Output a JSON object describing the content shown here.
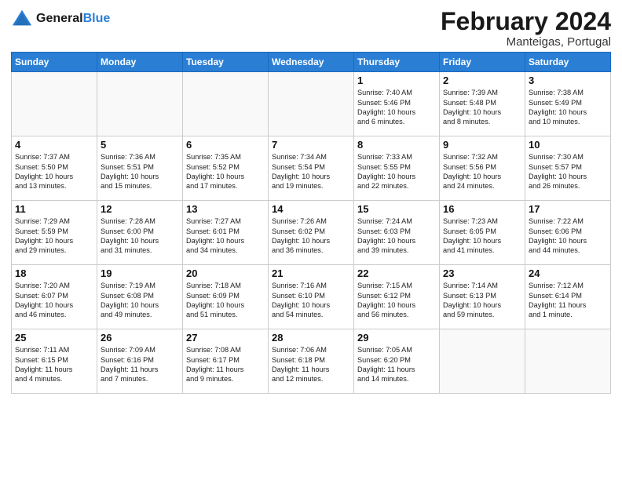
{
  "header": {
    "logo_line1": "General",
    "logo_line2": "Blue",
    "month": "February 2024",
    "location": "Manteigas, Portugal"
  },
  "days_of_week": [
    "Sunday",
    "Monday",
    "Tuesday",
    "Wednesday",
    "Thursday",
    "Friday",
    "Saturday"
  ],
  "weeks": [
    [
      {
        "day": "",
        "info": ""
      },
      {
        "day": "",
        "info": ""
      },
      {
        "day": "",
        "info": ""
      },
      {
        "day": "",
        "info": ""
      },
      {
        "day": "1",
        "info": "Sunrise: 7:40 AM\nSunset: 5:46 PM\nDaylight: 10 hours\nand 6 minutes."
      },
      {
        "day": "2",
        "info": "Sunrise: 7:39 AM\nSunset: 5:48 PM\nDaylight: 10 hours\nand 8 minutes."
      },
      {
        "day": "3",
        "info": "Sunrise: 7:38 AM\nSunset: 5:49 PM\nDaylight: 10 hours\nand 10 minutes."
      }
    ],
    [
      {
        "day": "4",
        "info": "Sunrise: 7:37 AM\nSunset: 5:50 PM\nDaylight: 10 hours\nand 13 minutes."
      },
      {
        "day": "5",
        "info": "Sunrise: 7:36 AM\nSunset: 5:51 PM\nDaylight: 10 hours\nand 15 minutes."
      },
      {
        "day": "6",
        "info": "Sunrise: 7:35 AM\nSunset: 5:52 PM\nDaylight: 10 hours\nand 17 minutes."
      },
      {
        "day": "7",
        "info": "Sunrise: 7:34 AM\nSunset: 5:54 PM\nDaylight: 10 hours\nand 19 minutes."
      },
      {
        "day": "8",
        "info": "Sunrise: 7:33 AM\nSunset: 5:55 PM\nDaylight: 10 hours\nand 22 minutes."
      },
      {
        "day": "9",
        "info": "Sunrise: 7:32 AM\nSunset: 5:56 PM\nDaylight: 10 hours\nand 24 minutes."
      },
      {
        "day": "10",
        "info": "Sunrise: 7:30 AM\nSunset: 5:57 PM\nDaylight: 10 hours\nand 26 minutes."
      }
    ],
    [
      {
        "day": "11",
        "info": "Sunrise: 7:29 AM\nSunset: 5:59 PM\nDaylight: 10 hours\nand 29 minutes."
      },
      {
        "day": "12",
        "info": "Sunrise: 7:28 AM\nSunset: 6:00 PM\nDaylight: 10 hours\nand 31 minutes."
      },
      {
        "day": "13",
        "info": "Sunrise: 7:27 AM\nSunset: 6:01 PM\nDaylight: 10 hours\nand 34 minutes."
      },
      {
        "day": "14",
        "info": "Sunrise: 7:26 AM\nSunset: 6:02 PM\nDaylight: 10 hours\nand 36 minutes."
      },
      {
        "day": "15",
        "info": "Sunrise: 7:24 AM\nSunset: 6:03 PM\nDaylight: 10 hours\nand 39 minutes."
      },
      {
        "day": "16",
        "info": "Sunrise: 7:23 AM\nSunset: 6:05 PM\nDaylight: 10 hours\nand 41 minutes."
      },
      {
        "day": "17",
        "info": "Sunrise: 7:22 AM\nSunset: 6:06 PM\nDaylight: 10 hours\nand 44 minutes."
      }
    ],
    [
      {
        "day": "18",
        "info": "Sunrise: 7:20 AM\nSunset: 6:07 PM\nDaylight: 10 hours\nand 46 minutes."
      },
      {
        "day": "19",
        "info": "Sunrise: 7:19 AM\nSunset: 6:08 PM\nDaylight: 10 hours\nand 49 minutes."
      },
      {
        "day": "20",
        "info": "Sunrise: 7:18 AM\nSunset: 6:09 PM\nDaylight: 10 hours\nand 51 minutes."
      },
      {
        "day": "21",
        "info": "Sunrise: 7:16 AM\nSunset: 6:10 PM\nDaylight: 10 hours\nand 54 minutes."
      },
      {
        "day": "22",
        "info": "Sunrise: 7:15 AM\nSunset: 6:12 PM\nDaylight: 10 hours\nand 56 minutes."
      },
      {
        "day": "23",
        "info": "Sunrise: 7:14 AM\nSunset: 6:13 PM\nDaylight: 10 hours\nand 59 minutes."
      },
      {
        "day": "24",
        "info": "Sunrise: 7:12 AM\nSunset: 6:14 PM\nDaylight: 11 hours\nand 1 minute."
      }
    ],
    [
      {
        "day": "25",
        "info": "Sunrise: 7:11 AM\nSunset: 6:15 PM\nDaylight: 11 hours\nand 4 minutes."
      },
      {
        "day": "26",
        "info": "Sunrise: 7:09 AM\nSunset: 6:16 PM\nDaylight: 11 hours\nand 7 minutes."
      },
      {
        "day": "27",
        "info": "Sunrise: 7:08 AM\nSunset: 6:17 PM\nDaylight: 11 hours\nand 9 minutes."
      },
      {
        "day": "28",
        "info": "Sunrise: 7:06 AM\nSunset: 6:18 PM\nDaylight: 11 hours\nand 12 minutes."
      },
      {
        "day": "29",
        "info": "Sunrise: 7:05 AM\nSunset: 6:20 PM\nDaylight: 11 hours\nand 14 minutes."
      },
      {
        "day": "",
        "info": ""
      },
      {
        "day": "",
        "info": ""
      }
    ]
  ]
}
